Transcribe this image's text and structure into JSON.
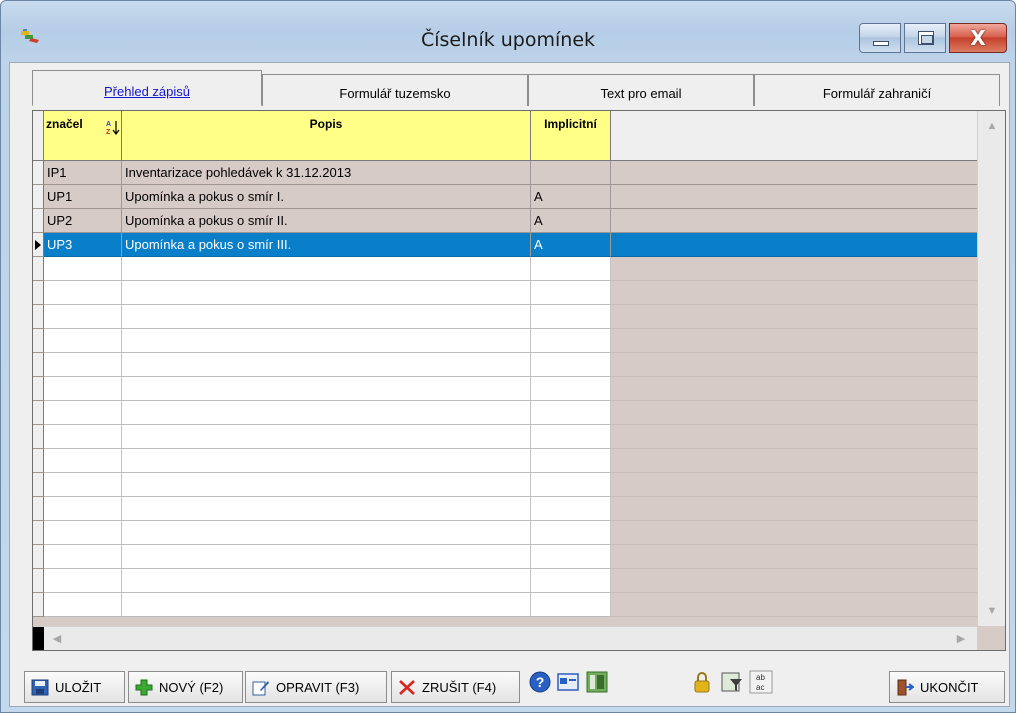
{
  "window": {
    "title": "Číselník upomínek",
    "minimize_icon": "minimize-icon",
    "maximize_icon": "maximize-icon",
    "close_icon": "close-icon",
    "close_glyph": "X"
  },
  "tabs": [
    {
      "label": "Přehled zápisů",
      "active": true
    },
    {
      "label": "Formulář tuzemsko",
      "active": false
    },
    {
      "label": "Text pro email",
      "active": false
    },
    {
      "label": "Formulář zahraničí",
      "active": false
    }
  ],
  "grid": {
    "columns": [
      {
        "label": "značel",
        "sortable": true
      },
      {
        "label": "Popis"
      },
      {
        "label": "Implicitní"
      }
    ],
    "rows": [
      {
        "code": "IP1",
        "popis": "Inventarizace pohledávek k 31.12.2013",
        "implicitni": ""
      },
      {
        "code": "UP1",
        "popis": "Upomínka a pokus o smír I.",
        "implicitni": "A"
      },
      {
        "code": "UP2",
        "popis": "Upomínka a pokus o smír II.",
        "implicitni": "A"
      },
      {
        "code": "UP3",
        "popis": "Upomínka a pokus o smír III.",
        "implicitni": "A",
        "selected": true
      }
    ],
    "empty_rows": 15,
    "colors": {
      "header": "#ffff88",
      "row_bg": "#d6cbc7",
      "selected": "#0a7fc9"
    }
  },
  "toolbar": {
    "save_label": "ULOŽIT",
    "new_label": "NOVÝ (F2)",
    "edit_label": "OPRAVIT (F3)",
    "delete_label": "ZRUŠIT (F4)",
    "quit_label": "UKONČIT",
    "icons": [
      "help-icon",
      "card-icon",
      "columns-icon",
      "lock-icon",
      "filter-icon",
      "spellcheck-icon"
    ]
  }
}
